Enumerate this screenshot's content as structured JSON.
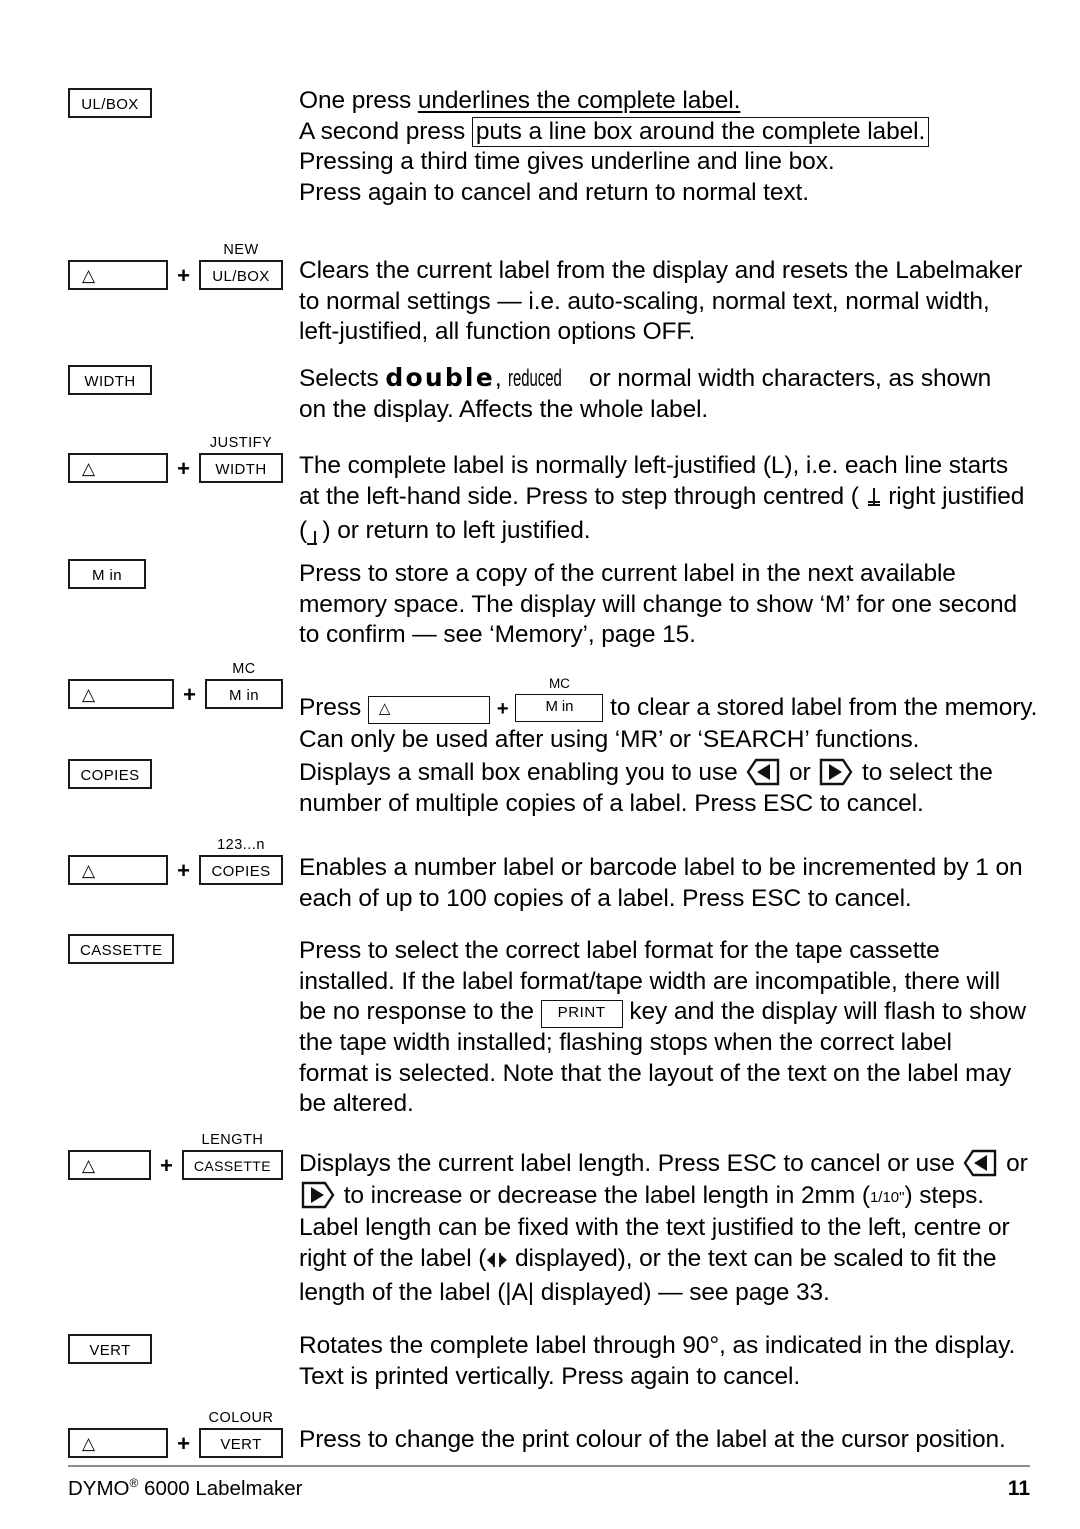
{
  "document": {
    "title": "DYMO 6000 Labelmaker key function reference",
    "page_number": "11",
    "footer_text": "DYMO",
    "footer_reg": "®",
    "footer_model": " 6000 Labelmaker"
  },
  "symbols": {
    "shift_triangle": "△",
    "plus": "+",
    "left_arrow": "left-arrow-key",
    "right_arrow": "right-arrow-key",
    "degree": "°"
  },
  "entries": [
    {
      "id": "ulbox",
      "key": {
        "type": "single",
        "label": "UL/BOX"
      },
      "lines": [
        {
          "segments": [
            {
              "text": "One press "
            },
            {
              "text": "underlines the complete label.",
              "style": "underline"
            }
          ]
        },
        {
          "segments": [
            {
              "text": "A second press "
            },
            {
              "text": "puts a line box around the complete label.",
              "style": "boxed"
            }
          ]
        },
        {
          "segments": [
            {
              "text": "Pressing a third time gives underline and line box."
            }
          ]
        },
        {
          "segments": [
            {
              "text": "Press again to cancel and return to normal text."
            }
          ]
        }
      ]
    },
    {
      "id": "new",
      "key": {
        "type": "combo",
        "shift_label": "△",
        "cap": "NEW",
        "label": "UL/BOX"
      },
      "lines": [
        {
          "segments": [
            {
              "text": "Clears the current label from the display and resets the Labelmaker"
            }
          ]
        },
        {
          "segments": [
            {
              "text": "to normal settings — i.e. auto-scaling, normal text, normal width,"
            }
          ]
        },
        {
          "segments": [
            {
              "text": "left-justified, all function options OFF."
            }
          ]
        }
      ]
    },
    {
      "id": "width",
      "key": {
        "type": "single",
        "label": "WIDTH"
      },
      "lines": [
        {
          "segments": [
            {
              "text": "Selects "
            },
            {
              "text": "double",
              "style": "double-width"
            },
            {
              "text": ", "
            },
            {
              "text": "reduced",
              "style": "reduced-width"
            },
            {
              "text": " or normal width characters, as shown"
            }
          ]
        },
        {
          "segments": [
            {
              "text": "on the display. Affects the whole label."
            }
          ]
        }
      ]
    },
    {
      "id": "justify",
      "key": {
        "type": "combo",
        "shift_label": "△",
        "cap": "JUSTIFY",
        "label": "WIDTH"
      },
      "lines": [
        {
          "segments": [
            {
              "text": "The complete label is normally left-justified (L), i.e. each line starts"
            }
          ]
        },
        {
          "segments": [
            {
              "text": "at the left-hand side. Press to step through centred ( "
            },
            {
              "text": "centre-justify-glyph",
              "style": "glyph"
            },
            {
              "text": " right justified"
            }
          ]
        },
        {
          "segments": [
            {
              "text": "( "
            },
            {
              "text": "right-justify-glyph",
              "style": "glyph"
            },
            {
              "text": " ) or return to left justified."
            }
          ]
        }
      ]
    },
    {
      "id": "min",
      "key": {
        "type": "single",
        "label": "M in"
      },
      "lines": [
        {
          "segments": [
            {
              "text": "Press to store a copy of the current label in the next available"
            }
          ]
        },
        {
          "segments": [
            {
              "text": "memory space. The display will change to show ‘M’ for one second"
            }
          ]
        },
        {
          "segments": [
            {
              "text": "to confirm — see ‘Memory’, page 15."
            }
          ]
        }
      ]
    },
    {
      "id": "mc",
      "key": {
        "type": "combo",
        "shift_label": "△",
        "cap": "MC",
        "label": "M in"
      },
      "lines": [
        {
          "segments": [
            {
              "text": "Press "
            },
            {
              "text": "inline-shift-key",
              "style": "inline-key-shift"
            },
            {
              "text": "+"
            },
            {
              "text": "inline-mc-key",
              "style": "inline-key-mc"
            },
            {
              "text": " to clear a stored label from the memory."
            }
          ]
        },
        {
          "segments": [
            {
              "text": "Can only be used after using ‘MR’ or ‘SEARCH’ functions."
            }
          ]
        }
      ]
    },
    {
      "id": "copies",
      "key": {
        "type": "single",
        "label": "COPIES"
      },
      "lines": [
        {
          "segments": [
            {
              "text": "Displays a small box enabling you to use "
            },
            {
              "text": "left-arrow",
              "style": "arrow-left"
            },
            {
              "text": " or "
            },
            {
              "text": "right-arrow",
              "style": "arrow-right"
            },
            {
              "text": " to select the"
            }
          ]
        },
        {
          "segments": [
            {
              "text": "number of multiple copies of a label. Press ESC to cancel."
            }
          ]
        }
      ]
    },
    {
      "id": "number",
      "key": {
        "type": "combo",
        "shift_label": "△",
        "cap": "123...n",
        "label": "COPIES"
      },
      "lines": [
        {
          "segments": [
            {
              "text": "Enables a number label or barcode label to be incremented by 1 on"
            }
          ]
        },
        {
          "segments": [
            {
              "text": "each of up to 100 copies of a label. Press ESC to cancel."
            }
          ]
        }
      ]
    },
    {
      "id": "cassette",
      "key": {
        "type": "single",
        "label": "CASSETTE"
      },
      "lines": [
        {
          "segments": [
            {
              "text": "Press to select the correct label format for the tape cassette"
            }
          ]
        },
        {
          "segments": [
            {
              "text": "installed. If the label format/tape width are incompatible, there will"
            }
          ]
        },
        {
          "segments": [
            {
              "text": "be no response to the "
            },
            {
              "text": "PRINT",
              "style": "inline-key-print"
            },
            {
              "text": " key and the display will flash to show"
            }
          ]
        },
        {
          "segments": [
            {
              "text": "the tape width installed; flashing stops when the correct label"
            }
          ]
        },
        {
          "segments": [
            {
              "text": "format is selected. Note that the layout of the text on the label may"
            }
          ]
        },
        {
          "segments": [
            {
              "text": "be altered."
            }
          ]
        }
      ]
    },
    {
      "id": "length",
      "key": {
        "type": "combo",
        "shift_label": "△",
        "cap": "LENGTH",
        "label": "CASSETTE"
      },
      "lines": [
        {
          "segments": [
            {
              "text": "Displays the current label length. Press ESC to cancel or use "
            },
            {
              "text": "left-arrow",
              "style": "arrow-left"
            },
            {
              "text": " or"
            }
          ]
        },
        {
          "segments": [
            {
              "text": "right-arrow",
              "style": "arrow-right"
            },
            {
              "text": " to increase or decrease the label length in 2mm ("
            },
            {
              "text": "1/10\"",
              "style": "fraction"
            },
            {
              "text": ") steps."
            }
          ]
        },
        {
          "segments": [
            {
              "text": "Label length can be fixed with the text justified to the left, centre or"
            }
          ]
        },
        {
          "segments": [
            {
              "text": "right of the label ("
            },
            {
              "text": "justify-arrows-glyph",
              "style": "glyph"
            },
            {
              "text": " displayed), or the text can be scaled to fit the"
            }
          ]
        },
        {
          "segments": [
            {
              "text": "length of the label (|A| displayed) — see page 33."
            }
          ]
        }
      ]
    },
    {
      "id": "vert",
      "key": {
        "type": "single",
        "label": "VERT"
      },
      "lines": [
        {
          "segments": [
            {
              "text": "Rotates the complete label through 90°, as indicated in the display."
            }
          ]
        },
        {
          "segments": [
            {
              "text": "Text is printed vertically. Press again to cancel."
            }
          ]
        }
      ]
    },
    {
      "id": "colour",
      "key": {
        "type": "combo",
        "shift_label": "△",
        "cap": "COLOUR",
        "label": "VERT"
      },
      "lines": [
        {
          "segments": [
            {
              "text": "Press to change the print colour of the label at the cursor position."
            }
          ]
        }
      ]
    }
  ]
}
